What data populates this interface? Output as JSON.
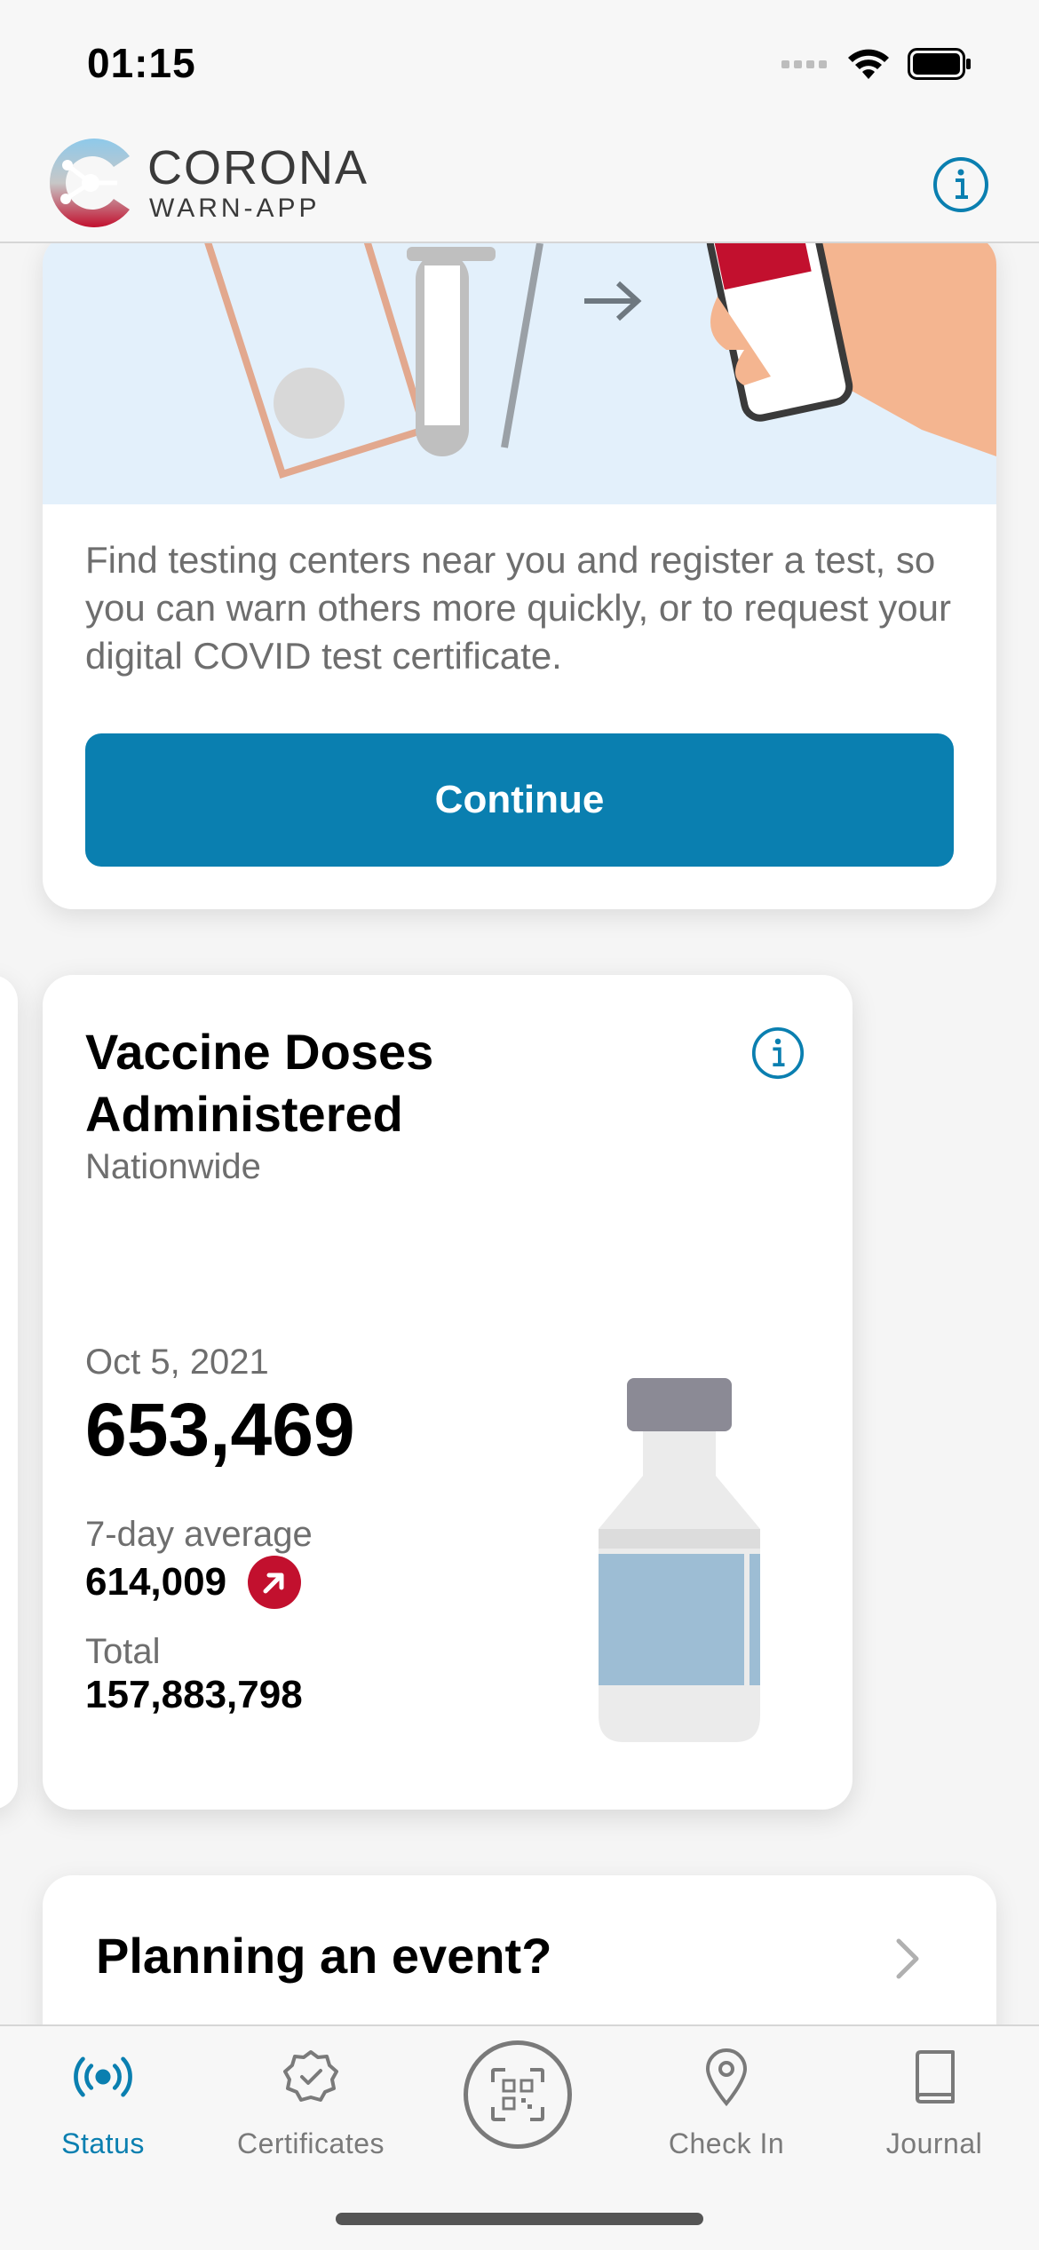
{
  "status_bar": {
    "time": "01:15"
  },
  "header": {
    "app_name_line1": "CORONA",
    "app_name_line2": "WARN-APP",
    "info_icon": "info-icon"
  },
  "test_card": {
    "description": "Find testing centers near you and register a test, so you can warn others more quickly, or to request your digital COVID test certificate.",
    "button_label": "Continue"
  },
  "vaccine_card": {
    "title": "Vaccine Doses Administered",
    "subtitle": "Nationwide",
    "date": "Oct 5, 2021",
    "value": "653,469",
    "avg_label": "7-day average",
    "avg_value": "614,009",
    "trend": "up",
    "total_label": "Total",
    "total_value": "157,883,798"
  },
  "event_card": {
    "title": "Planning an event?"
  },
  "tabs": [
    {
      "label": "Status",
      "icon": "broadcast-icon",
      "active": true
    },
    {
      "label": "Certificates",
      "icon": "certificate-icon",
      "active": false
    },
    {
      "label": "",
      "icon": "qr-scan-icon",
      "active": false
    },
    {
      "label": "Check In",
      "icon": "location-pin-icon",
      "active": false
    },
    {
      "label": "Journal",
      "icon": "book-icon",
      "active": false
    }
  ],
  "colors": {
    "accent": "#0a7fb0",
    "trend_red": "#c2102e"
  }
}
